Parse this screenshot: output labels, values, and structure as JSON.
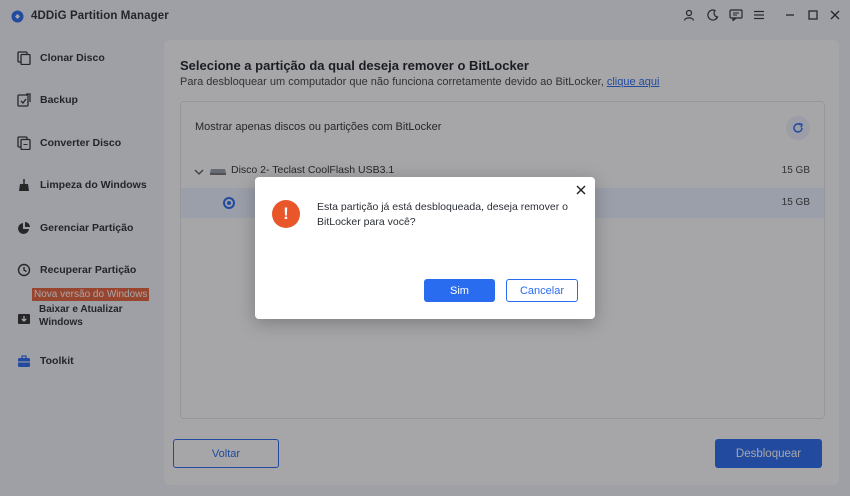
{
  "app": {
    "title": "4DDiG Partition Manager"
  },
  "colors": {
    "accent": "#2a6cf0",
    "badge": "#e8633a",
    "warning": "#e8562a"
  },
  "window_controls": [
    "user-icon",
    "theme-icon",
    "feedback-icon",
    "menu-icon",
    "minimize-icon",
    "maximize-icon",
    "close-icon"
  ],
  "sidebar": {
    "items": [
      {
        "label": "Clonar Disco",
        "icon": "clone-disk-icon"
      },
      {
        "label": "Backup",
        "icon": "backup-icon"
      },
      {
        "label": "Converter Disco",
        "icon": "convert-disk-icon"
      },
      {
        "label": "Limpeza do Windows",
        "icon": "broom-icon"
      },
      {
        "label": "Gerenciar Partição",
        "icon": "pie-chart-icon"
      },
      {
        "label": "Recuperar Partição",
        "icon": "recover-icon"
      },
      {
        "label": "Baixar e Atualizar Windows",
        "icon": "windows-update-icon",
        "badge": "Nova versão do Windows"
      },
      {
        "label": "Toolkit",
        "icon": "toolkit-icon"
      }
    ]
  },
  "main": {
    "title": "Selecione a partição da qual deseja remover o BitLocker",
    "subtitle": "Para desbloquear um computador que não funciona corretamente devido ao BitLocker,",
    "subtitle_link": "clique aqui",
    "filter_label": "Mostrar apenas discos ou partições com BitLocker",
    "disk": {
      "name": "Disco 2- Teclast CoolFlash USB3.1",
      "size": "15 GB"
    },
    "partition": {
      "size": "15 GB"
    },
    "back_label": "Voltar",
    "unlock_label": "Desbloquear"
  },
  "dialog": {
    "message": "Esta partição já está desbloqueada, deseja remover o BitLocker para você?",
    "yes_label": "Sim",
    "cancel_label": "Cancelar"
  }
}
